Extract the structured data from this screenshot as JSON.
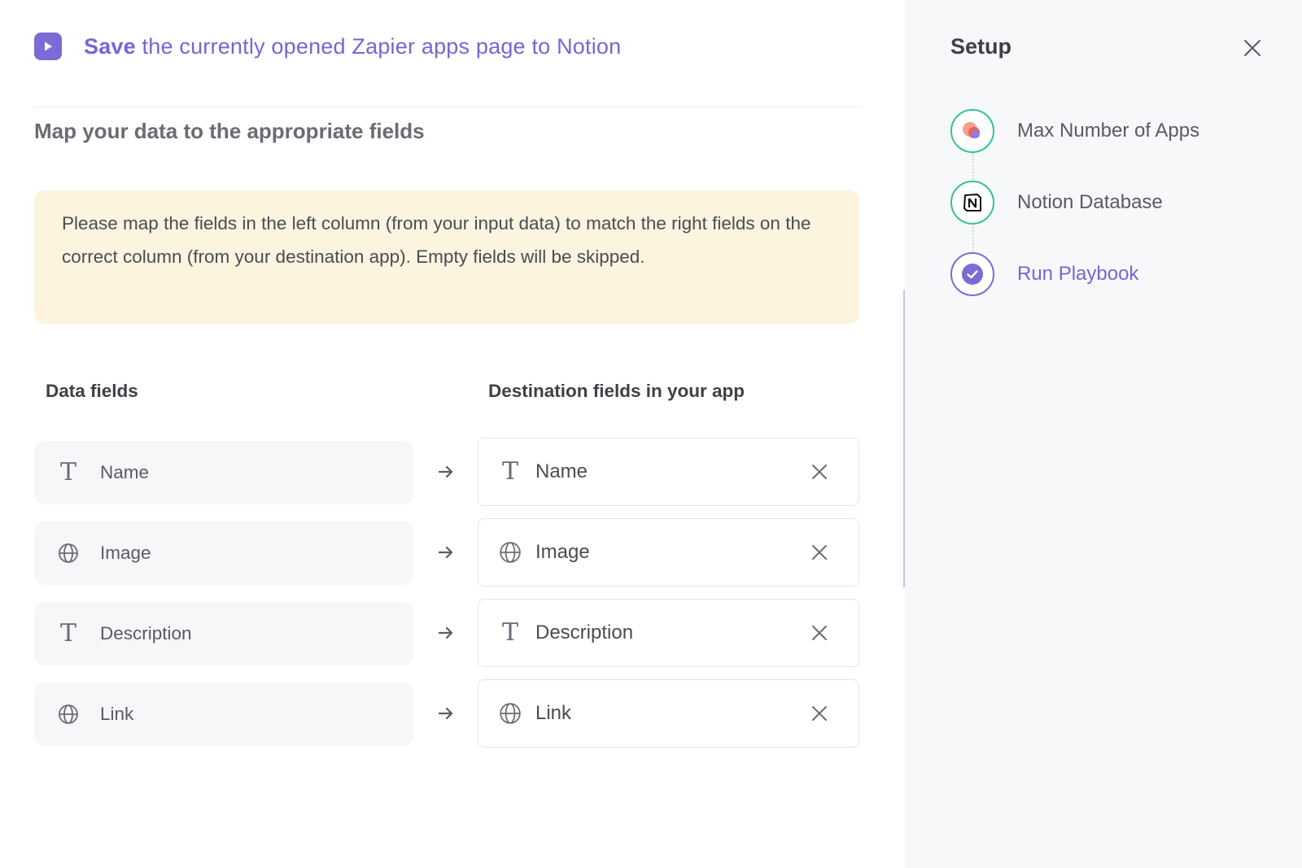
{
  "header": {
    "title_bold": "Save",
    "title_rest": " the currently opened Zapier apps page to Notion",
    "icon": "play-icon"
  },
  "section_title": "Map your data to the appropriate fields",
  "notice": "Please map the fields in the left column (from your input data) to match the right fields on the correct column (from your destination app). Empty fields will be skipped.",
  "columns": {
    "left": "Data fields",
    "right": "Destination fields in your app"
  },
  "mappings": [
    {
      "source": "Name",
      "source_icon": "text-type-icon",
      "destination": "Name",
      "destination_icon": "text-type-icon"
    },
    {
      "source": "Image",
      "source_icon": "globe-icon",
      "destination": "Image",
      "destination_icon": "globe-icon"
    },
    {
      "source": "Description",
      "source_icon": "text-type-icon",
      "destination": "Description",
      "destination_icon": "text-type-icon"
    },
    {
      "source": "Link",
      "source_icon": "globe-icon",
      "destination": "Link",
      "destination_icon": "globe-icon"
    }
  ],
  "glyphs": {
    "text_type": "T"
  },
  "setup": {
    "title": "Setup",
    "steps": [
      {
        "label": "Max Number of Apps",
        "icon": "zapier-app-icon",
        "state": "done"
      },
      {
        "label": "Notion Database",
        "icon": "notion-icon",
        "state": "done"
      },
      {
        "label": "Run Playbook",
        "icon": "check-circle-icon",
        "state": "active"
      }
    ]
  },
  "colors": {
    "accent": "#7765d6",
    "step_done": "#34c38f",
    "notice_bg": "#fdf4e0",
    "side_bg": "#f7f8fa"
  }
}
